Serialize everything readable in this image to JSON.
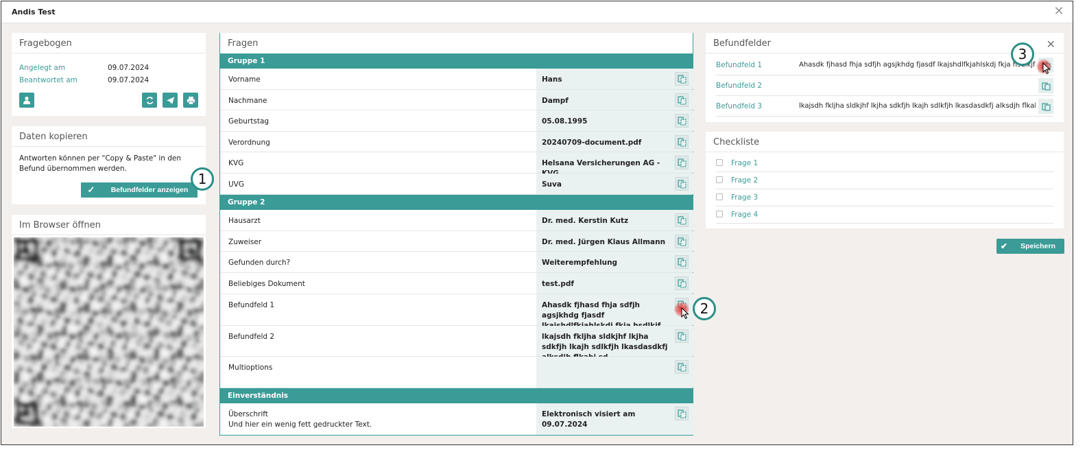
{
  "window": {
    "title": "Andis Test"
  },
  "fragebogen": {
    "title": "Fragebogen",
    "fields": [
      {
        "label": "Angelegt am",
        "value": "09.07.2024"
      },
      {
        "label": "Beantwortet am",
        "value": "09.07.2024"
      }
    ],
    "icons": [
      "user-icon",
      "refresh-icon",
      "send-icon",
      "print-icon"
    ]
  },
  "daten": {
    "title": "Daten kopieren",
    "text": "Antworten können per \"Copy & Paste\" in den Befund übernommen werden.",
    "button_label": "Befundfelder anzeigen"
  },
  "browser": {
    "title": "Im Browser öffnen"
  },
  "fragen": {
    "title": "Fragen",
    "groups": [
      {
        "name": "Gruppe 1",
        "rows": [
          {
            "label": "Vorname",
            "value": "Hans"
          },
          {
            "label": "Nachmane",
            "value": "Dampf"
          },
          {
            "label": "Geburtstag",
            "value": "05.08.1995"
          },
          {
            "label": "Verordnung",
            "value": "20240709-document.pdf"
          },
          {
            "label": "KVG",
            "value": "Helsana Versicherungen AG - KVG"
          },
          {
            "label": "UVG",
            "value": "Suva"
          }
        ]
      },
      {
        "name": "Gruppe 2",
        "rows": [
          {
            "label": "Hausarzt",
            "value": "Dr. med. Kerstin Kutz"
          },
          {
            "label": "Zuweiser",
            "value": "Dr. med. Jürgen Klaus Allmann"
          },
          {
            "label": "Gefunden durch?",
            "value": "Weiterempfehlung"
          },
          {
            "label": "Beliebiges Dokument",
            "value": "test.pdf"
          },
          {
            "label": "Befundfeld 1",
            "value": "Ahasdk fjhasd fhja sdfjh agsjkhdg fjasdf lkajshdlfkjahlskdj fkja hsdlkjf"
          },
          {
            "label": "Befundfeld 2",
            "value": "lkajsdh fkljha sldkjhf lkjha sdkfjh lkajh sdlkfjh lkasdasdkfj alksdjh flkahj sd"
          },
          {
            "label": "Multioptions",
            "value": ""
          }
        ]
      },
      {
        "name": "Einverständnis",
        "rows": [
          {
            "label": "Überschrift",
            "label2": "Und hier ein wenig fett gedruckter Text.",
            "value": "Elektronisch visiert am 09.07.2024"
          }
        ]
      }
    ]
  },
  "befundfelder": {
    "title": "Befundfelder",
    "rows": [
      {
        "label": "Befundfeld 1",
        "value": "Ahasdk fjhasd fhja sdfjh agsjkhdg fjasdf lkajshdlfkjahlskdj fkja hsdlkjf"
      },
      {
        "label": "Befundfeld 2",
        "value": ""
      },
      {
        "label": "Befundfeld 3",
        "value": "lkajsdh fkljha sldkjhf lkjha sdkfjh lkajh sdlkfjh lkasdasdkfj alksdjh flkahj sd"
      }
    ]
  },
  "checkliste": {
    "title": "Checkliste",
    "items": [
      "Frage 1",
      "Frage 2",
      "Frage 3",
      "Frage 4"
    ]
  },
  "save_label": "Speichern",
  "callouts": [
    "1",
    "2",
    "3"
  ],
  "colors": {
    "accent": "#3a9b97",
    "background": "#f2efec",
    "highlight": "#eaf2f1"
  }
}
